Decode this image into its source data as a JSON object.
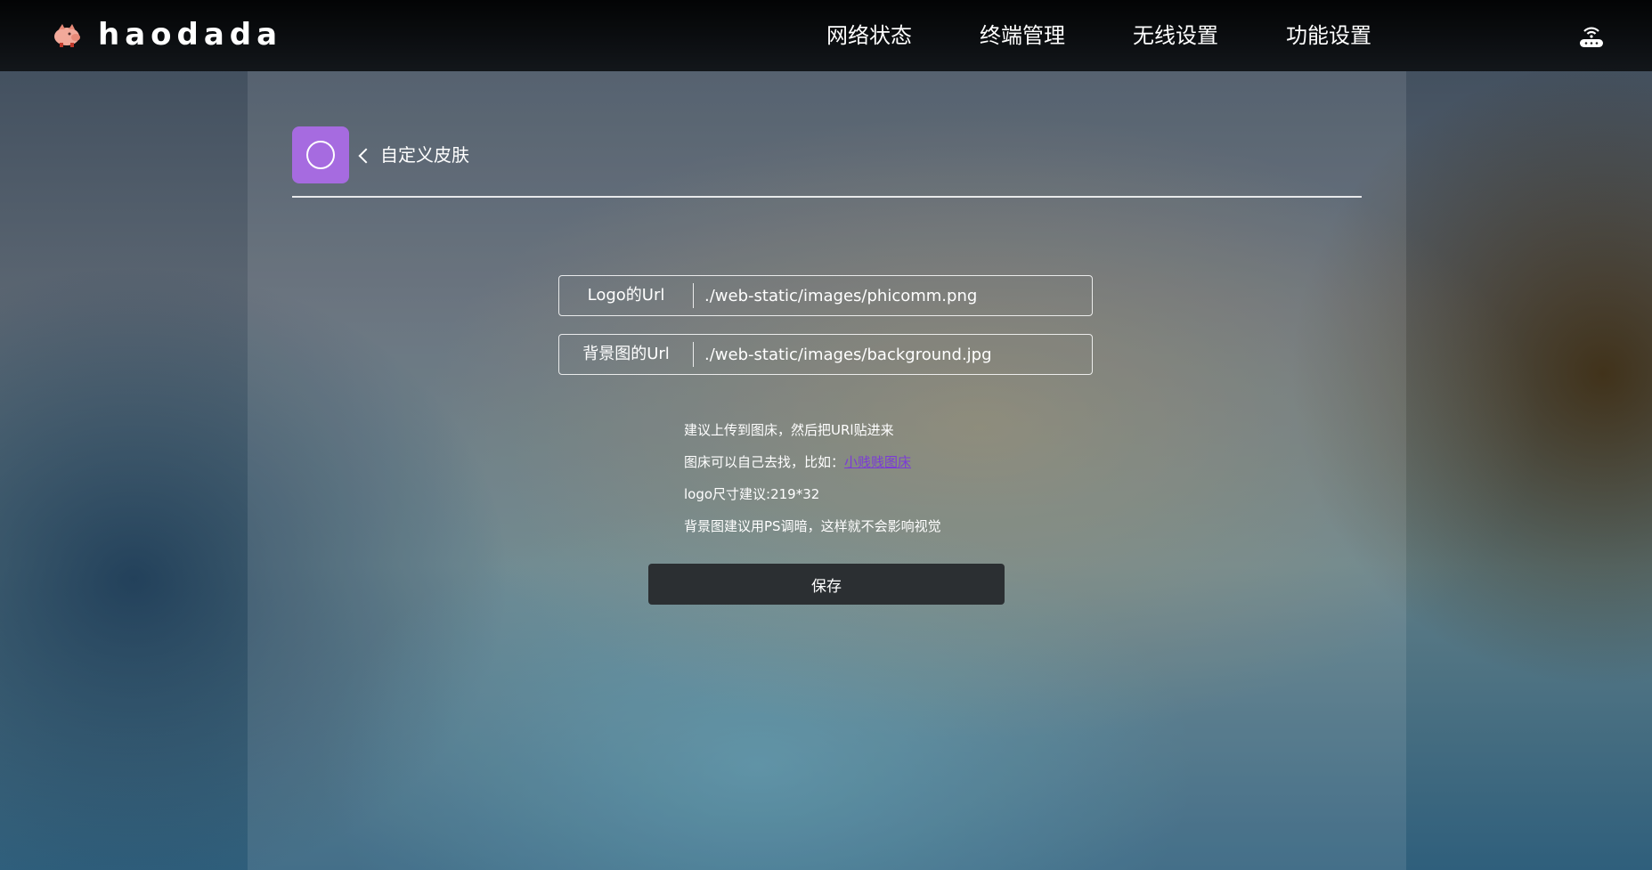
{
  "brand": {
    "name": "haodada",
    "logo_icon": "pig-icon"
  },
  "nav": {
    "items": [
      "网络状态",
      "终端管理",
      "无线设置",
      "功能设置"
    ],
    "router_icon": "router-icon"
  },
  "page": {
    "title": "自定义皮肤",
    "icon": "skin-circle-icon",
    "icon_color": "#a66be0"
  },
  "form": {
    "logo_url": {
      "label": "Logo的Url",
      "value": "./web-static/images/phicomm.png"
    },
    "bg_url": {
      "label": "背景图的Url",
      "value": "./web-static/images/background.jpg"
    }
  },
  "tips": {
    "line1": "建议上传到图床，然后把URl贴进来",
    "line2_prefix": "图床可以自己去找，比如：",
    "line2_link": "小贱贱图床",
    "line3": "logo尺寸建议:219*32",
    "line4": "背景图建议用PS调暗，这样就不会影响视觉"
  },
  "actions": {
    "save_label": "保存"
  },
  "colors": {
    "accent": "#a66be0",
    "link": "#7b3bd6",
    "button_bg": "#2b2f32"
  }
}
